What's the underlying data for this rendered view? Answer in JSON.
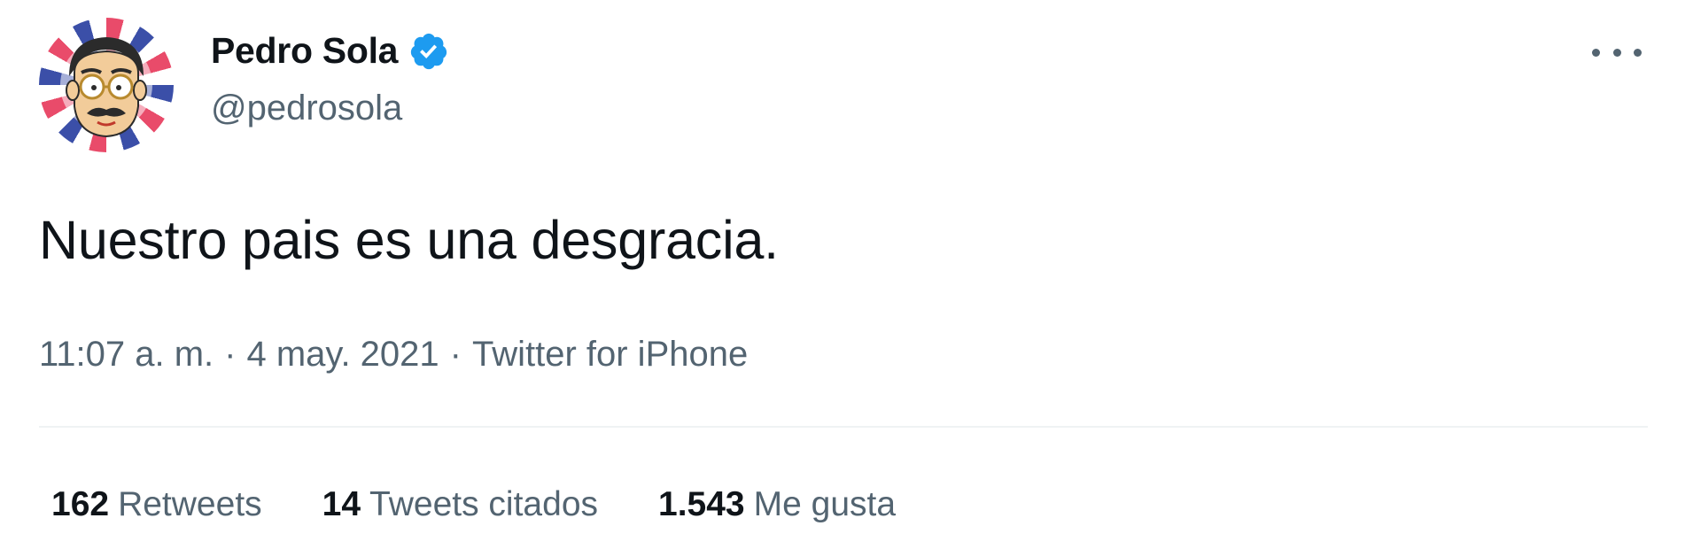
{
  "author": {
    "display_name": "Pedro Sola",
    "handle": "@pedrosola",
    "verified": true,
    "verified_icon": "verified-badge-icon",
    "avatar_icon": "cartoon-avatar-icon"
  },
  "tweet": {
    "text": "Nuestro pais es una desgracia.",
    "time": "11:07 a. m.",
    "date": "4 may. 2021",
    "source": "Twitter for iPhone",
    "separator": "·"
  },
  "menu": {
    "icon": "more-options-icon"
  },
  "stats": [
    {
      "count": "162",
      "label": "Retweets"
    },
    {
      "count": "14",
      "label": "Tweets citados"
    },
    {
      "count": "1.543",
      "label": "Me gusta"
    }
  ],
  "colors": {
    "verified_blue": "#1d9bf0",
    "text_primary": "#0f1419",
    "text_secondary": "#536471",
    "divider": "#eff3f4"
  }
}
